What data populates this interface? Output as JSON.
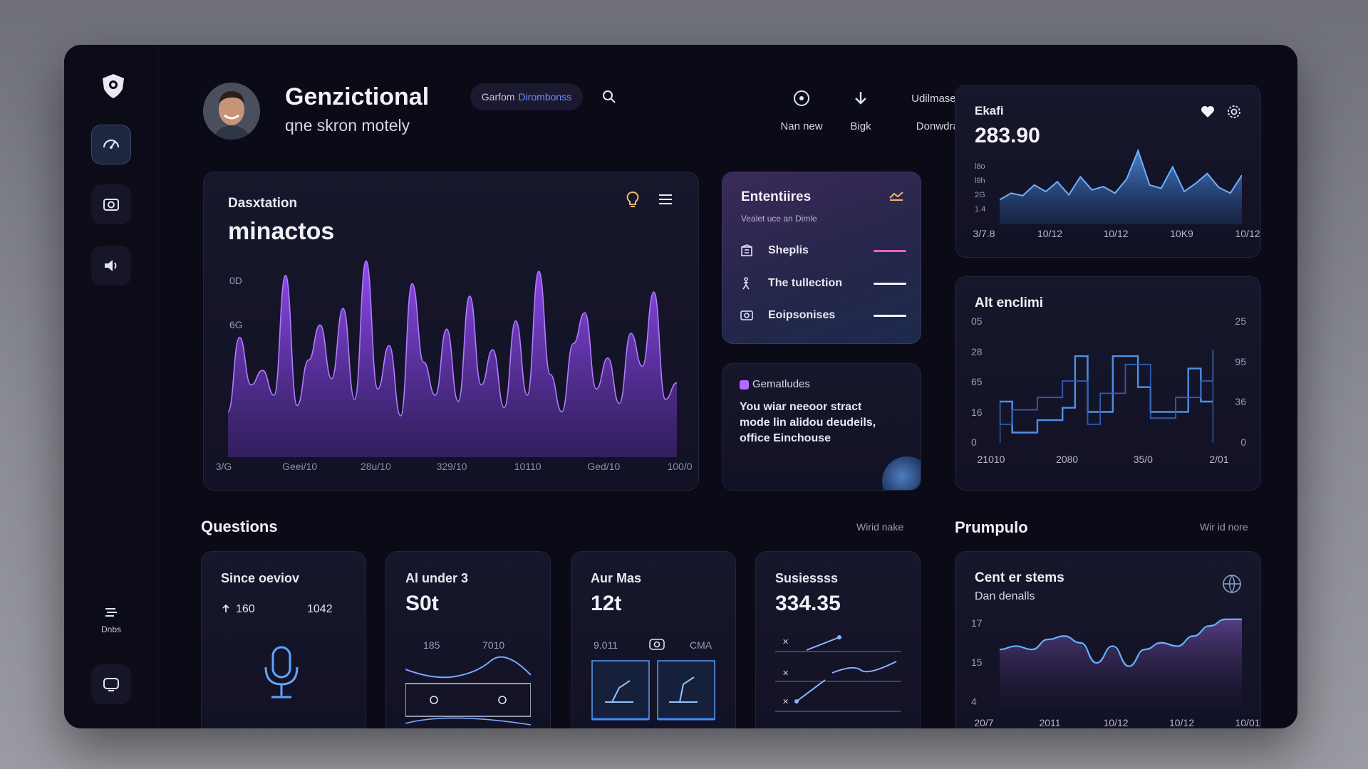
{
  "header": {
    "title": "Genzictional",
    "subtitle": "qne skron motely",
    "filter_label": "Garfom",
    "filter_value": "Dirombonss",
    "actions": [
      {
        "label": "Nan new"
      },
      {
        "label": "Bigk"
      },
      {
        "label": "Donwdrat",
        "top_label": "Udilmased"
      }
    ]
  },
  "sidebar": {
    "bottom_label": "Dnbs"
  },
  "main_chart": {
    "label": "Dasxtation",
    "title": "minactos",
    "y_ticks": [
      "0D",
      "6G"
    ],
    "x_ticks": [
      "3/G",
      "Geei/10",
      "28u/10",
      "329/10",
      "10110",
      "Ged/10",
      "100/0"
    ],
    "chart_data": {
      "type": "area",
      "x": [
        "3/G",
        "Geei/10",
        "28u/10",
        "329/10",
        "10110",
        "Ged/10",
        "100/0"
      ],
      "series": [
        {
          "values": [
            22,
            58,
            35,
            42,
            30,
            88,
            25,
            47,
            64,
            38,
            72,
            28,
            95,
            33,
            54,
            20,
            84,
            46,
            30,
            62,
            27,
            78,
            35,
            52,
            24,
            66,
            30,
            90,
            40,
            22,
            55,
            70,
            33,
            48,
            26,
            60,
            44,
            80,
            28,
            36
          ]
        }
      ],
      "ylim": [
        0,
        100
      ]
    }
  },
  "entities": {
    "title": "Ententiires",
    "subtitle": "Vealet uce an Dimle",
    "items": [
      {
        "label": "Sheplis",
        "color": "#e560c8"
      },
      {
        "label": "The tullection",
        "color": "#f3f3f8"
      },
      {
        "label": "Eoipsonises",
        "color": "#f3f3f8"
      }
    ]
  },
  "note": {
    "tag": "Gematludes",
    "text_lines": [
      "You wiar neeoor stract",
      "mode lin alidou deudeils,",
      "office Einchouse"
    ]
  },
  "stat_card": {
    "label": "Ekafi",
    "value": "283.90",
    "y_ticks": [
      "l8o",
      "l9h",
      "2G",
      "1.4"
    ],
    "x_ticks": [
      "3/7.8",
      "10/12",
      "10/12",
      "10K9",
      "10/12"
    ],
    "chart_data": {
      "type": "area",
      "x": [
        "3/7.8",
        "10/12",
        "10/12",
        "10K9",
        "10/12"
      ],
      "series": [
        {
          "values": [
            30,
            38,
            35,
            48,
            40,
            52,
            36,
            58,
            42,
            46,
            38,
            55,
            90,
            48,
            44,
            70,
            40,
            50,
            62,
            45,
            38,
            60
          ]
        }
      ]
    }
  },
  "alt_chart": {
    "title": "Alt enclimi",
    "y_left": [
      "05",
      "28",
      "65",
      "16",
      "0"
    ],
    "y_right": [
      "25",
      "95",
      "36",
      "0"
    ],
    "x_ticks": [
      "21010",
      "2080",
      "35/0",
      "2/01"
    ],
    "chart_data": {
      "type": "line",
      "x": [
        "21010",
        "2080",
        "35/0",
        "2/01"
      ],
      "series": [
        {
          "values": [
            40,
            10,
            10,
            22,
            22,
            34,
            84,
            30,
            30,
            84,
            84,
            54,
            30,
            30,
            30,
            72,
            40,
            90
          ]
        },
        {
          "values": [
            18,
            32,
            32,
            44,
            44,
            60,
            60,
            18,
            48,
            48,
            76,
            76,
            24,
            24,
            44,
            44,
            60,
            60
          ]
        }
      ]
    }
  },
  "questions": {
    "title": "Questions",
    "link": "Wirid nake",
    "cards": [
      {
        "title": "Since oeviov",
        "v1": "160",
        "v2": "1042"
      },
      {
        "title": "Al under 3",
        "value": "S0t",
        "a": "185",
        "b": "7010"
      },
      {
        "title": "Aur Mas",
        "value": "12t",
        "a": "9.011",
        "b": "CMA"
      },
      {
        "title": "Susiessss",
        "value": "334.35"
      }
    ]
  },
  "prumpulo": {
    "title": "Prumpulo",
    "link": "Wir id nore",
    "card_title": "Cent er stems",
    "card_sub": "Dan denalls",
    "y_ticks": [
      "17",
      "15",
      "4"
    ],
    "x_ticks": [
      "20/7",
      "2011",
      "10/12",
      "10/12",
      "10/01"
    ],
    "chart_data": {
      "type": "line",
      "x": [
        "20/7",
        "2011",
        "10/12",
        "10/12",
        "10/01"
      ],
      "series": [
        {
          "values": [
            13,
            13.5,
            13,
            14.5,
            15,
            14,
            11,
            13.5,
            10.5,
            13,
            14,
            13.5,
            15,
            16.5,
            17.5,
            17.5
          ]
        }
      ],
      "ylim": [
        4,
        18
      ]
    }
  }
}
